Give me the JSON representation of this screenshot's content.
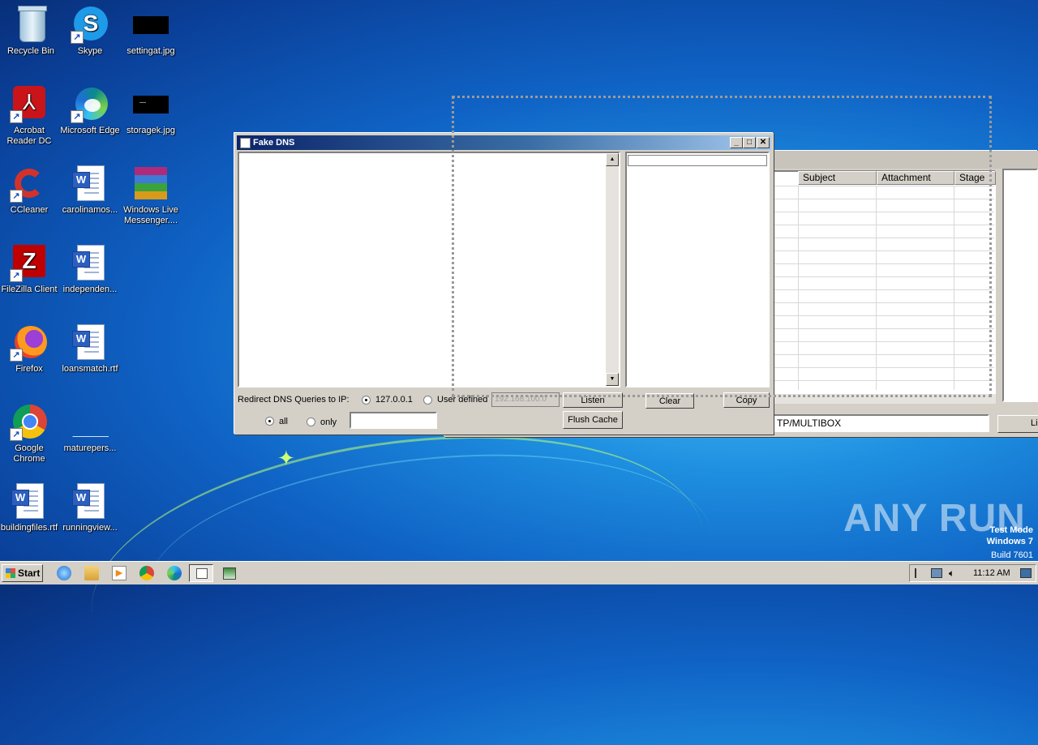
{
  "desktop": {
    "icons": [
      {
        "label": "Recycle Bin"
      },
      {
        "label": "Skype"
      },
      {
        "label": "settingat.jpg"
      },
      {
        "label": "Acrobat Reader DC"
      },
      {
        "label": "Microsoft Edge"
      },
      {
        "label": "storagek.jpg"
      },
      {
        "label": "CCleaner"
      },
      {
        "label": "carolinamos..."
      },
      {
        "label": "Windows Live Messenger...."
      },
      {
        "label": "FileZilla Client"
      },
      {
        "label": "independen..."
      },
      {
        "label": "Firefox"
      },
      {
        "label": "loansmatch.rtf"
      },
      {
        "label": "Google Chrome"
      },
      {
        "label": "maturepers..."
      },
      {
        "label": "buildingfiles.rtf"
      },
      {
        "label": "runningview..."
      }
    ]
  },
  "fake_dns": {
    "title": "Fake DNS",
    "redirect_label": "Redirect DNS Queries to IP:",
    "radio_localhost": "127.0.0.1",
    "radio_user_defined": "User defined",
    "user_ip_value": "192.168.100.0",
    "listen_button": "Listen",
    "clear_button": "Clear",
    "copy_button": "Copy",
    "flush_cache_button": "Flush Cache",
    "radio_all": "all",
    "radio_only": "only",
    "only_value": ""
  },
  "bg_window": {
    "columns": [
      "Subject",
      "Attachment",
      "Stage"
    ],
    "address_value": "TP/MULTIBOX",
    "partial_button": "Li"
  },
  "watermark": {
    "text": "ANY RUN",
    "test_mode": "Test Mode",
    "os": "Windows 7",
    "build": "Build 7601"
  },
  "taskbar": {
    "start_label": "Start",
    "clock": "11:12 AM"
  }
}
